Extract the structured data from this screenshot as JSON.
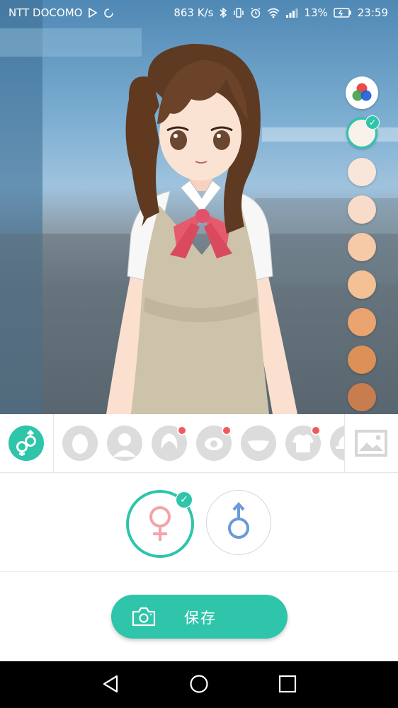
{
  "status_bar": {
    "carrier": "NTT DOCOMO",
    "speed": "863 K/s",
    "battery": "13%",
    "time": "23:59"
  },
  "swatches": {
    "colors": [
      "#f8f2ea",
      "#f9e6da",
      "#f8dcc9",
      "#f6caa6",
      "#f3c194",
      "#eaa46f",
      "#dc9158",
      "#c87d4e"
    ],
    "selected_index": 0
  },
  "toolbar": {
    "gender_toggle_icon": "gender-icon",
    "categories": [
      {
        "name": "face-shape-icon",
        "badge": false
      },
      {
        "name": "head-silhouette-icon",
        "badge": false
      },
      {
        "name": "hair-icon",
        "badge": true
      },
      {
        "name": "eye-icon",
        "badge": true
      },
      {
        "name": "mouth-icon",
        "badge": false
      },
      {
        "name": "shirt-icon",
        "badge": true
      },
      {
        "name": "hat-icon",
        "badge": false
      }
    ],
    "image_icon": "image-icon"
  },
  "gender": {
    "female_symbol": "♀",
    "male_symbol": "♂",
    "selected": "female"
  },
  "save": {
    "label": "保存"
  },
  "accent_color": "#2ec5aa",
  "badge_color": "#f25a5a"
}
